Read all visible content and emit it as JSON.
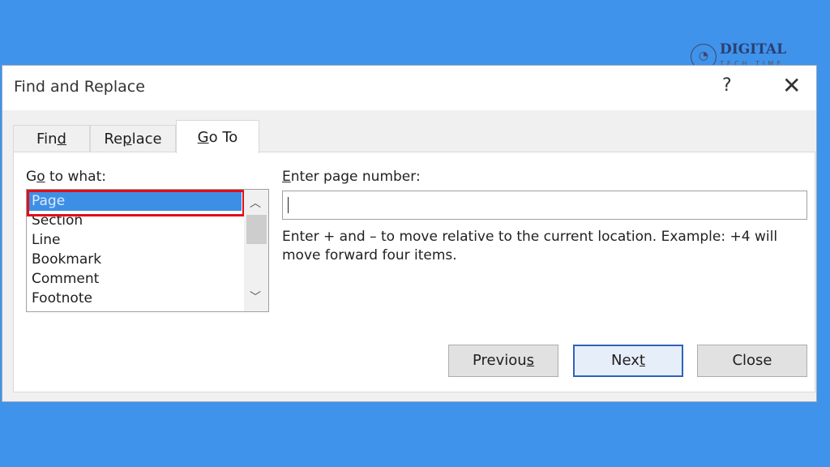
{
  "window": {
    "title": "Find and Replace",
    "help": "?",
    "close": "✕"
  },
  "watermark": {
    "icon": "clock-logo",
    "line1": "DIGITAL",
    "line2": "TECH TIME"
  },
  "tabs": [
    {
      "pre": "Fin",
      "key": "d",
      "post": ""
    },
    {
      "pre": "Re",
      "key": "p",
      "post": "lace"
    },
    {
      "pre": "",
      "key": "G",
      "post": "o To",
      "active": true
    }
  ],
  "goto": {
    "label": {
      "pre": "G",
      "key": "o",
      "post": " to what:"
    },
    "items": [
      "Page",
      "Section",
      "Line",
      "Bookmark",
      "Comment",
      "Footnote"
    ],
    "selected": "Page",
    "highlight_color": "#e0101a"
  },
  "page": {
    "label": {
      "pre": "",
      "key": "E",
      "post": "nter page number:"
    },
    "value": "",
    "hint": "Enter + and – to move relative to the current location. Example: +4 will move forward four items."
  },
  "buttons": [
    {
      "pre": "Previou",
      "key": "s",
      "post": ""
    },
    {
      "pre": "Nex",
      "key": "t",
      "post": "",
      "default": true
    },
    {
      "pre": "Close",
      "key": "",
      "post": ""
    }
  ],
  "colors": {
    "background": "#3f93ea",
    "selection": "#3d8fe6",
    "default_button_border": "#2f63b8"
  }
}
